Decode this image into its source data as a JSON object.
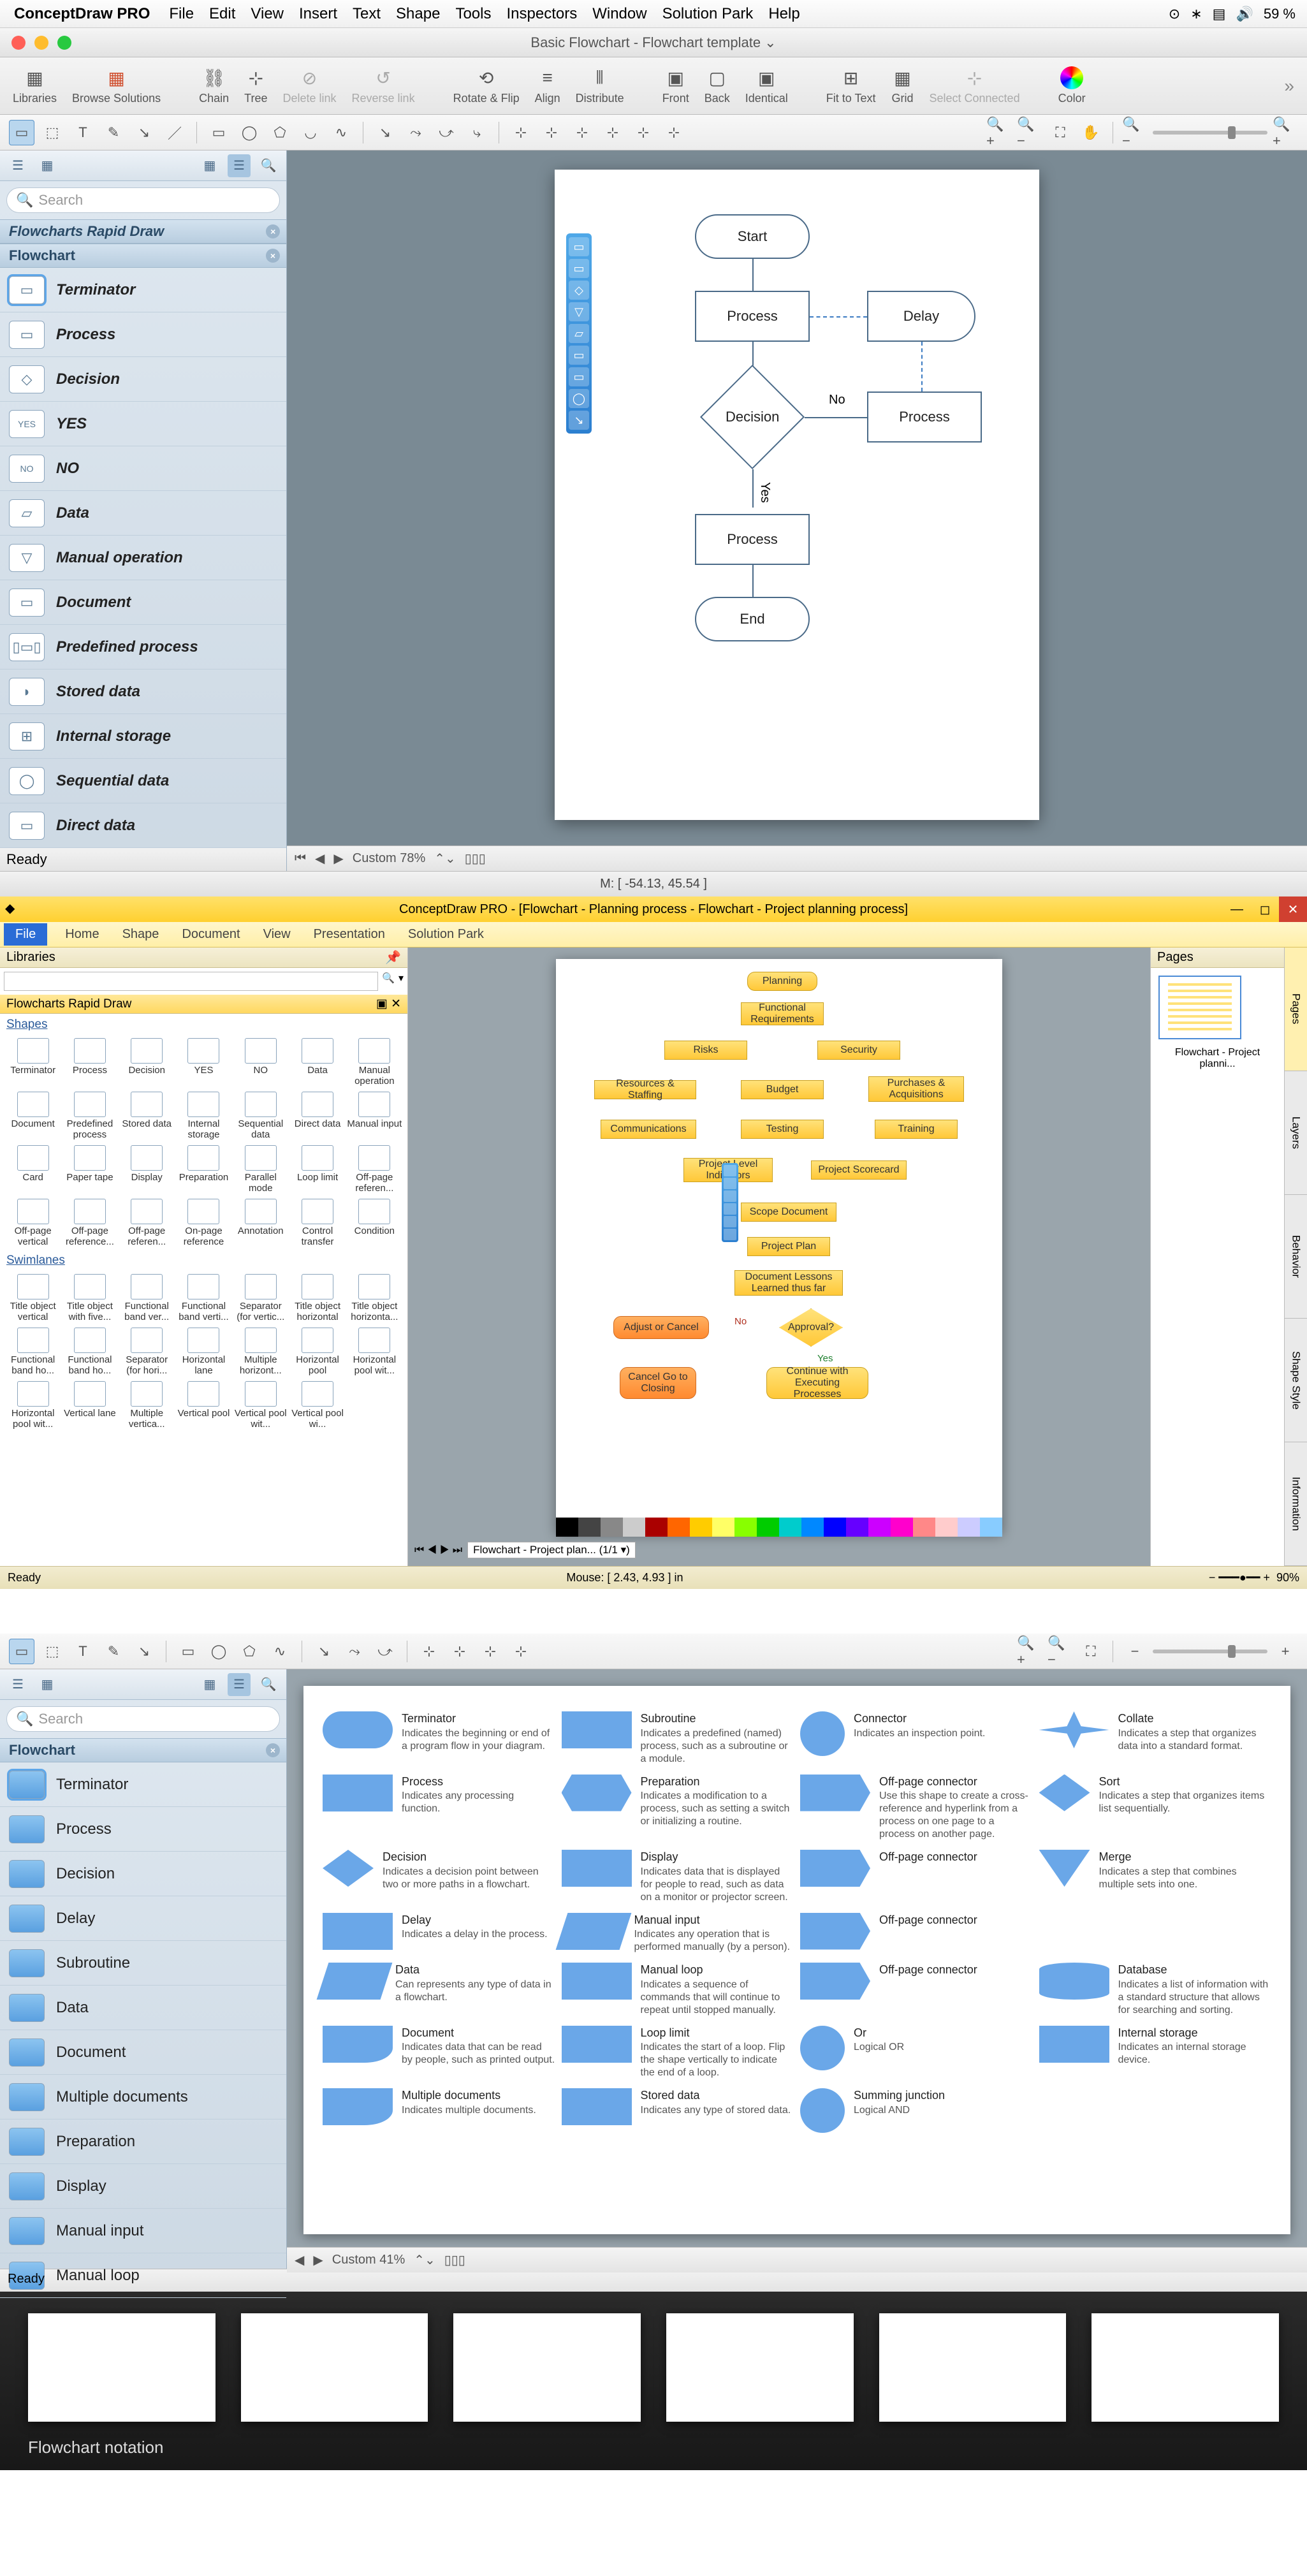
{
  "menubar": {
    "app": "ConceptDraw PRO",
    "items": [
      "File",
      "Edit",
      "View",
      "Insert",
      "Text",
      "Shape",
      "Tools",
      "Inspectors",
      "Window",
      "Solution Park",
      "Help"
    ],
    "battery": "59 %"
  },
  "doc_title": "Basic Flowchart - Flowchart template",
  "ribbon": {
    "groups": [
      [
        "Libraries",
        "Browse Solutions"
      ],
      [
        "Chain",
        "Tree",
        "Delete link",
        "Reverse link"
      ],
      [
        "Rotate & Flip",
        "Align",
        "Distribute"
      ],
      [
        "Front",
        "Back",
        "Identical"
      ],
      [
        "Fit to Text",
        "Grid",
        "Select Connected"
      ],
      [
        "Color"
      ]
    ]
  },
  "sidebar1": {
    "search_ph": "Search",
    "sec1": "Flowcharts Rapid Draw",
    "sec2": "Flowchart",
    "items": [
      "Terminator",
      "Process",
      "Decision",
      "YES",
      "NO",
      "Data",
      "Manual operation",
      "Document",
      "Predefined process",
      "Stored data",
      "Internal storage",
      "Sequential data",
      "Direct data"
    ]
  },
  "canvas1": {
    "nodes": {
      "start": "Start",
      "p1": "Process",
      "delay": "Delay",
      "dec": "Decision",
      "p2": "Process",
      "p3": "Process",
      "end": "End",
      "no": "No",
      "yes": "Yes"
    },
    "zoom": "Custom 78%",
    "mouse": "M: [ -54.13, 45.54 ]",
    "ready": "Ready"
  },
  "win": {
    "title": "ConceptDraw PRO - [Flowchart - Planning process - Flowchart - Project planning process]",
    "menu_file": "File",
    "menu": [
      "Home",
      "Shape",
      "Document",
      "View",
      "Presentation",
      "Solution Park"
    ],
    "lib_h": "Libraries",
    "rd_h": "Flowcharts Rapid Draw",
    "sections": {
      "shapes": "Shapes",
      "swim": "Swimlanes"
    },
    "shapes1": [
      "Terminator",
      "Process",
      "Decision",
      "YES",
      "NO",
      "Data",
      "Manual operation"
    ],
    "shapes2": [
      "Document",
      "Predefined process",
      "Stored data",
      "Internal storage",
      "Sequential data",
      "Direct data",
      "Manual input"
    ],
    "shapes3": [
      "Card",
      "Paper tape",
      "Display",
      "Preparation",
      "Parallel mode",
      "Loop limit",
      "Off-page referen..."
    ],
    "shapes4": [
      "Off-page vertical",
      "Off-page reference...",
      "Off-page referen...",
      "On-page reference",
      "Annotation",
      "Control transfer",
      "Condition"
    ],
    "swim1": [
      "Title object vertical",
      "Title object with five...",
      "Functional band ver...",
      "Functional band verti...",
      "Separator (for vertic...",
      "Title object horizontal",
      "Title object horizonta..."
    ],
    "swim2": [
      "Functional band ho...",
      "Functional band ho...",
      "Separator (for hori...",
      "Horizontal lane",
      "Multiple horizont...",
      "Horizontal pool",
      "Horizontal pool wit..."
    ],
    "swim3": [
      "Horizontal pool wit...",
      "Vertical lane",
      "Multiple vertica...",
      "Vertical pool",
      "Vertical pool wit...",
      "Vertical pool wi..."
    ],
    "pages_h": "Pages",
    "thumb": "Flowchart - Project planni...",
    "tabs": [
      "Pages",
      "Layers",
      "Behavior",
      "Shape Style",
      "Information"
    ],
    "tab_label": "Flowchart - Project plan...  (1/1 ▾)",
    "mouse": "Mouse: [ 2.43, 4.93 ] in",
    "zoom": "90%",
    "ready": "Ready",
    "nodes": [
      "Planning",
      "Functional Requirements",
      "Risks",
      "Security",
      "Resources & Staffing",
      "Budget",
      "Purchases & Acquisitions",
      "Communications",
      "Testing",
      "Training",
      "Project Level Indicators",
      "Project Scorecard",
      "Scope Document",
      "Project Plan",
      "Document Lessons Learned thus far",
      "Adjust or Cancel",
      "Approval?",
      "Cancel Go to Closing",
      "Continue with Executing Processes",
      "No",
      "Yes"
    ]
  },
  "s3": {
    "search_ph": "Search",
    "panel": "Flowchart",
    "items": [
      "Terminator",
      "Process",
      "Decision",
      "Delay",
      "Subroutine",
      "Data",
      "Document",
      "Multiple documents",
      "Preparation",
      "Display",
      "Manual input",
      "Manual loop"
    ],
    "zoom": "Custom 41%",
    "ready": "Ready",
    "ref": [
      {
        "n": "Terminator",
        "d": "Indicates the beginning or end of a program flow in your diagram."
      },
      {
        "n": "Subroutine",
        "d": "Indicates a predefined (named) process, such as a subroutine or a module."
      },
      {
        "n": "Connector",
        "d": "Indicates an inspection point."
      },
      {
        "n": "Collate",
        "d": "Indicates a step that organizes data into a standard format."
      },
      {
        "n": "Process",
        "d": "Indicates any processing function."
      },
      {
        "n": "Preparation",
        "d": "Indicates a modification to a process, such as setting a switch or initializing a routine."
      },
      {
        "n": "Off-page connector",
        "d": "Use this shape to create a cross-reference and hyperlink from a process on one page to a process on another page."
      },
      {
        "n": "Sort",
        "d": "Indicates a step that organizes items list sequentially."
      },
      {
        "n": "Decision",
        "d": "Indicates a decision point between two or more paths in a flowchart."
      },
      {
        "n": "Display",
        "d": "Indicates data that is displayed for people to read, such as data on a monitor or projector screen."
      },
      {
        "n": "Off-page connector",
        "d": ""
      },
      {
        "n": "Merge",
        "d": "Indicates a step that combines multiple sets into one."
      },
      {
        "n": "Delay",
        "d": "Indicates a delay in the process."
      },
      {
        "n": "Manual input",
        "d": "Indicates any operation that is performed manually (by a person)."
      },
      {
        "n": "Off-page connector",
        "d": ""
      },
      {
        "n": "",
        "d": ""
      },
      {
        "n": "Data",
        "d": "Can represents any type of data in a flowchart."
      },
      {
        "n": "Manual loop",
        "d": "Indicates a sequence of commands that will continue to repeat until stopped manually."
      },
      {
        "n": "Off-page connector",
        "d": ""
      },
      {
        "n": "Database",
        "d": "Indicates a list of information with a standard structure that allows for searching and sorting."
      },
      {
        "n": "Document",
        "d": "Indicates data that can be read by people, such as printed output."
      },
      {
        "n": "Loop limit",
        "d": "Indicates the start of a loop. Flip the shape vertically to indicate the end of a loop."
      },
      {
        "n": "Or",
        "d": "Logical OR"
      },
      {
        "n": "Internal storage",
        "d": "Indicates an internal storage device."
      },
      {
        "n": "Multiple documents",
        "d": "Indicates multiple documents."
      },
      {
        "n": "Stored data",
        "d": "Indicates any type of stored data."
      },
      {
        "n": "Summing junction",
        "d": "Logical AND"
      },
      {
        "n": "",
        "d": ""
      }
    ]
  },
  "gallery": {
    "caption": "Flowchart notation"
  }
}
